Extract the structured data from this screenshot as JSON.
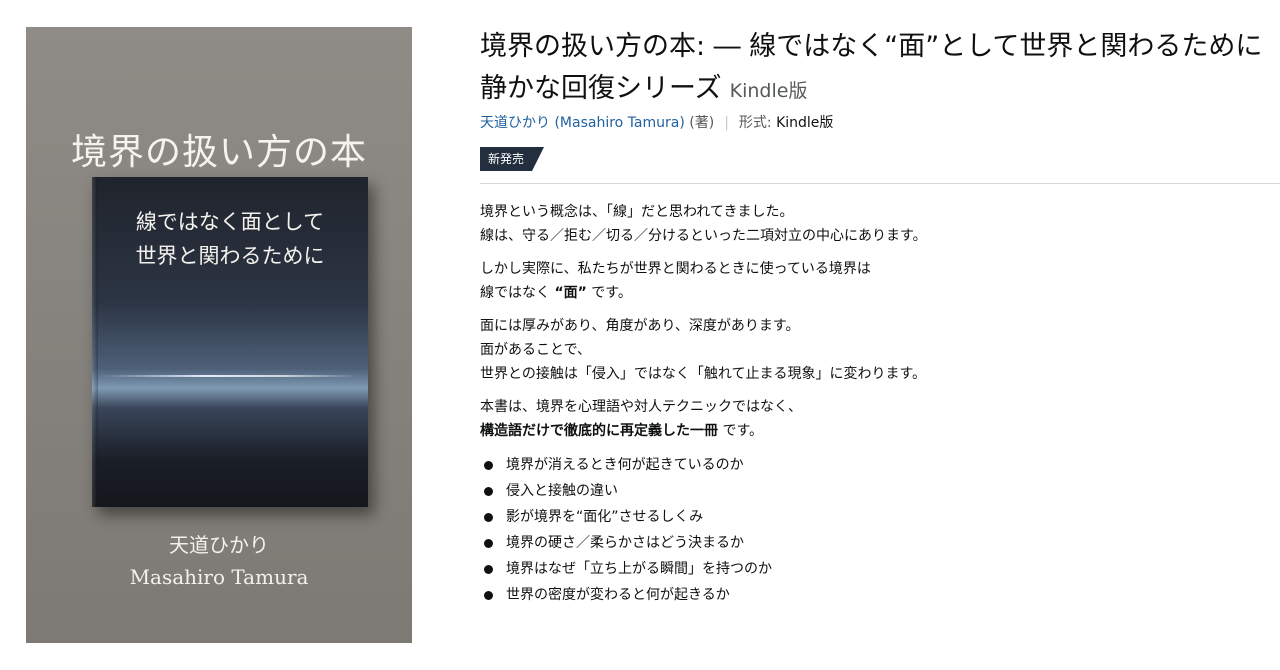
{
  "cover": {
    "title": "境界の扱い方の本",
    "subtitle_line1": "線ではなく面として",
    "subtitle_line2": "世界と関わるために",
    "author_ja": "天道ひかり",
    "author_en": "Masahiro Tamura"
  },
  "product": {
    "title_line1": "境界の扱い方の本: ― 線ではなく“面”として世界と関わるために",
    "title_line2": "静かな回復シリーズ",
    "format_suffix": "Kindle版",
    "author": "天道ひかり (Masahiro Tamura)",
    "author_role": "(著)",
    "format_label": "形式:",
    "format_value": "Kindle版",
    "badge": "新発売"
  },
  "description": {
    "p1_line1": "境界という概念は、「線」だと思われてきました。",
    "p1_line2": "線は、守る／拒む／切る／分けるといった二項対立の中心にあります。",
    "p2_line1": "しかし実際に、私たちが世界と関わるときに使っている境界は",
    "p2_line2_a": "線ではなく ",
    "p2_line2_b": "“面”",
    "p2_line2_c": " です。",
    "p3_line1": "面には厚みがあり、角度があり、深度があります。",
    "p3_line2": "面があることで、",
    "p3_line3": "世界との接触は「侵入」ではなく「触れて止まる現象」に変わります。",
    "p4_line1": "本書は、境界を心理語や対人テクニックではなく、",
    "p4_line2_b": "構造語だけで徹底的に再定義した一冊",
    "p4_line2_c": " です。",
    "bullets": [
      "境界が消えるとき何が起きているのか",
      "侵入と接触の違い",
      "影が境界を“面化”させるしくみ",
      "境界の硬さ／柔らかさはどう決まるか",
      "境界はなぜ「立ち上がる瞬間」を持つのか",
      "世界の密度が変わると何が起きるか"
    ]
  }
}
